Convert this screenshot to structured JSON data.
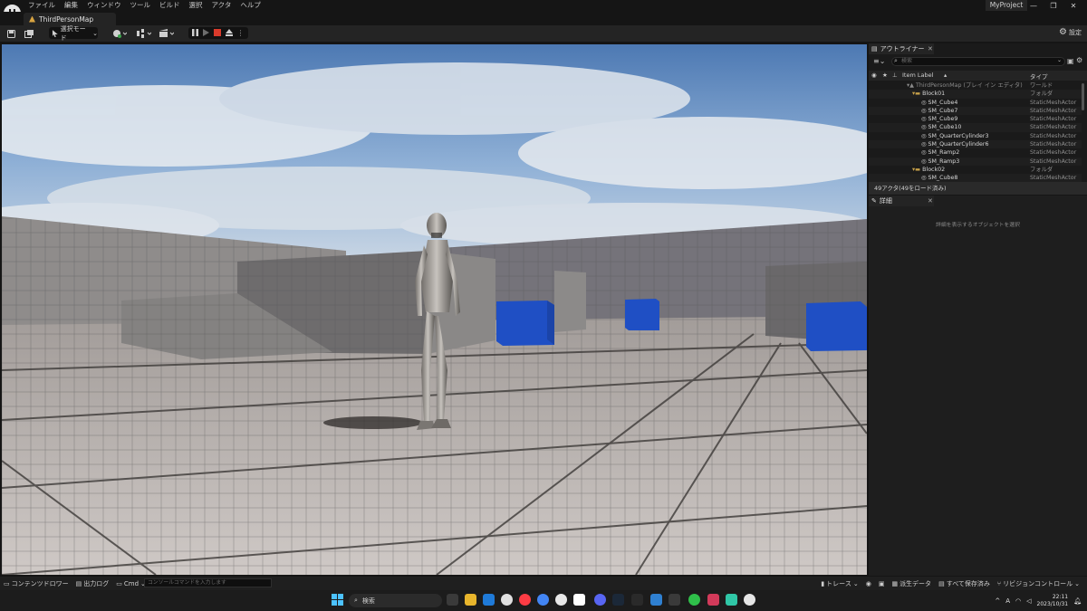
{
  "menu": {
    "items": [
      "ファイル",
      "編集",
      "ウィンドウ",
      "ツール",
      "ビルド",
      "選択",
      "アクタ",
      "ヘルプ"
    ],
    "project_name": "MyProject"
  },
  "window_controls": {
    "minimize": "—",
    "maximize": "❐",
    "close": "✕"
  },
  "document_tab": {
    "label": "ThirdPersonMap"
  },
  "toolbar": {
    "mode_label": "選択モード",
    "settings_label": "設定"
  },
  "outliner": {
    "tab_label": "アウトライナー",
    "search_placeholder": "検索",
    "col_label": "Item Label",
    "col_type": "タイプ",
    "rows": [
      {
        "label": "ThirdPersonMap (プレイ イン エディタ)",
        "type": "ワールド",
        "kind": "world"
      },
      {
        "label": "Block01",
        "type": "フォルダ",
        "kind": "folder"
      },
      {
        "label": "SM_Cube4",
        "type": "StaticMeshActor",
        "kind": "actor"
      },
      {
        "label": "SM_Cube7",
        "type": "StaticMeshActor",
        "kind": "actor"
      },
      {
        "label": "SM_Cube9",
        "type": "StaticMeshActor",
        "kind": "actor"
      },
      {
        "label": "SM_Cube10",
        "type": "StaticMeshActor",
        "kind": "actor"
      },
      {
        "label": "SM_QuarterCylinder3",
        "type": "StaticMeshActor",
        "kind": "actor"
      },
      {
        "label": "SM_QuarterCylinder6",
        "type": "StaticMeshActor",
        "kind": "actor"
      },
      {
        "label": "SM_Ramp2",
        "type": "StaticMeshActor",
        "kind": "actor"
      },
      {
        "label": "SM_Ramp3",
        "type": "StaticMeshActor",
        "kind": "actor"
      },
      {
        "label": "Block02",
        "type": "フォルダ",
        "kind": "folder"
      },
      {
        "label": "SM_Cube8",
        "type": "StaticMeshActor",
        "kind": "actor"
      }
    ],
    "status": "49アクタ(49をロード済み)"
  },
  "details": {
    "tab_label": "詳細",
    "hint": "詳細を表示するオブジェクトを選択"
  },
  "bottombar": {
    "content_drawer": "コンテンツドロワー",
    "output_log": "出力ログ",
    "cmd": "Cmd",
    "cmd_placeholder": "コンソールコマンドを入力します",
    "trace": "トレース",
    "derived_data": "派生データ",
    "save_all": "すべて保存済み",
    "revision_control": "リビジョンコントロール"
  },
  "taskbar": {
    "search_label": "検索",
    "ime": "A",
    "time": "22:11",
    "date": "2023/10/31",
    "tray_caret": "^"
  },
  "colors": {
    "accent_cube": "#1f4fc4",
    "play_stop": "#d93a2b",
    "folder": "#c9a24a"
  }
}
